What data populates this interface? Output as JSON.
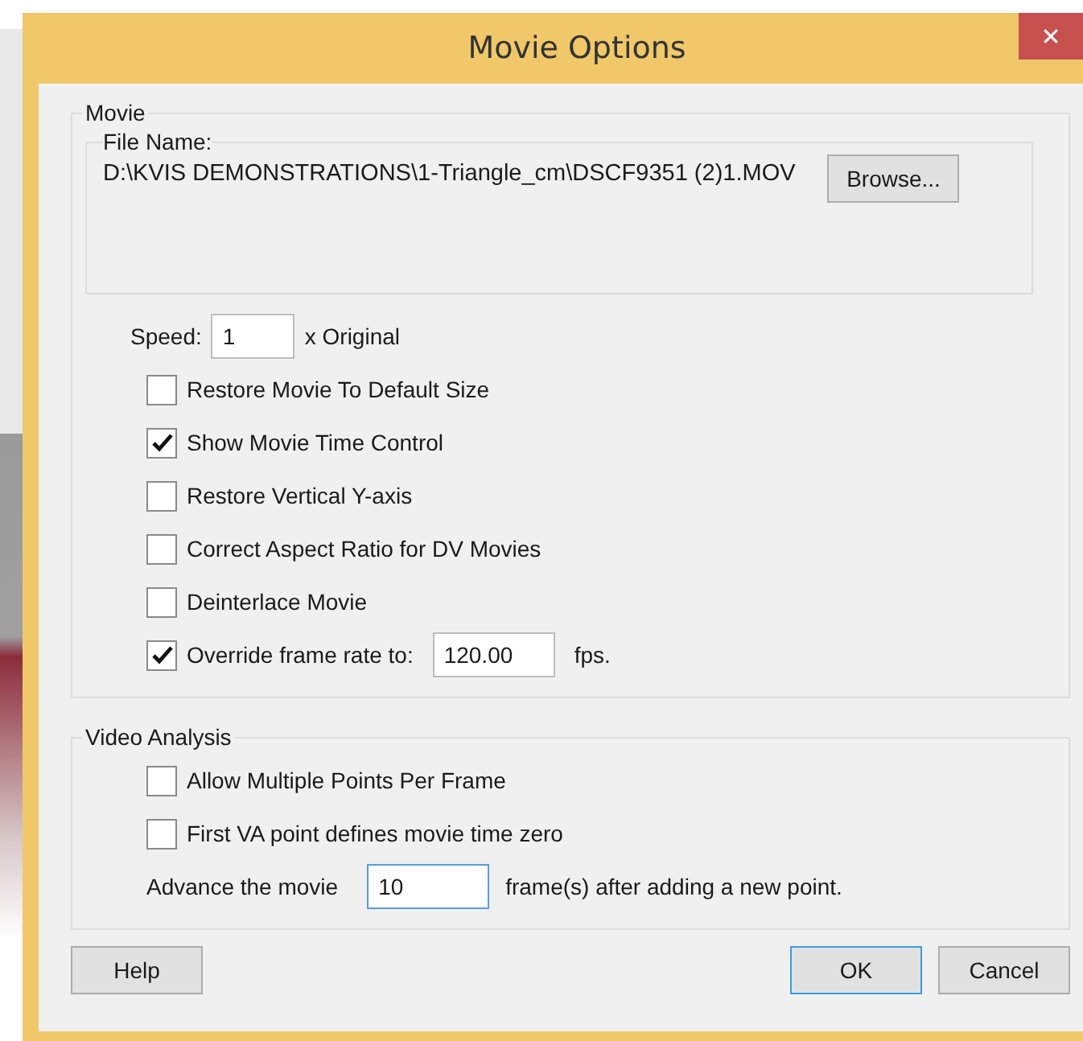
{
  "window": {
    "title": "Movie Options",
    "close": "✕"
  },
  "movie": {
    "legend": "Movie",
    "file_name_label": "File Name:",
    "file_path": "D:\\KVIS DEMONSTRATIONS\\1-Triangle_cm\\DSCF9351 (2)1.MOV",
    "browse_button": "Browse...",
    "speed": {
      "label": "Speed:",
      "value": "1",
      "suffix": "x Original"
    },
    "options": [
      {
        "label": "Restore Movie To Default Size",
        "checked": false
      },
      {
        "label": "Show Movie Time Control",
        "checked": true
      },
      {
        "label": "Restore Vertical Y-axis",
        "checked": false
      },
      {
        "label": "Correct Aspect Ratio for DV Movies",
        "checked": false
      },
      {
        "label": "Deinterlace Movie",
        "checked": false
      }
    ],
    "frame_rate": {
      "label": "Override frame rate to:",
      "checked": true,
      "value": "120.00",
      "unit": "fps."
    }
  },
  "video_analysis": {
    "legend": "Video Analysis",
    "options": [
      {
        "label": "Allow Multiple Points Per Frame",
        "checked": false
      },
      {
        "label": "First VA point defines movie time zero",
        "checked": false
      }
    ],
    "advance": {
      "label": "Advance the movie",
      "value": "10",
      "suffix": "frame(s) after adding a new point.",
      "focused": true
    }
  },
  "buttons": [
    {
      "label": "Help",
      "default": false
    },
    {
      "label": "OK",
      "default": true
    },
    {
      "label": "Cancel",
      "default": false
    }
  ]
}
